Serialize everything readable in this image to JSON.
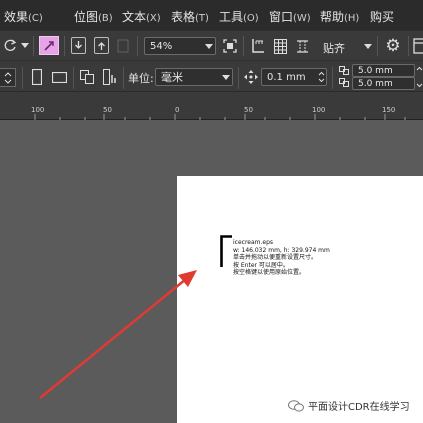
{
  "menu": {
    "items": [
      {
        "label": "效果",
        "hotkey": "(C)"
      },
      {
        "label": "位图",
        "hotkey": "(B)"
      },
      {
        "label": "文本",
        "hotkey": "(X)"
      },
      {
        "label": "表格",
        "hotkey": "(T)"
      },
      {
        "label": "工具",
        "hotkey": "(O)"
      },
      {
        "label": "窗口",
        "hotkey": "(W)"
      },
      {
        "label": "帮助",
        "hotkey": "(H)"
      },
      {
        "label": "购买",
        "hotkey": ""
      }
    ]
  },
  "toolbar": {
    "zoom_value": "54%",
    "snap_label": "贴齐"
  },
  "propertybar": {
    "units_label": "单位:",
    "units_value": "毫米",
    "nudge_value": "0.1 mm",
    "dup_x": "5.0 mm",
    "dup_y": "5.0 mm"
  },
  "ruler": {
    "ticks": [
      "100",
      "50",
      "0",
      "50",
      "100",
      "150"
    ]
  },
  "tooltip": {
    "filename": "icecream.eps",
    "size": "w: 146.032 mm, h: 329.974 mm",
    "line1": "单击并拖动以便重新设置尺寸。",
    "line2": "按 Enter 可以居中。",
    "line3": "按空格键以使用原始位置。"
  },
  "watermark": {
    "text": "平面设计CDR在线学习"
  },
  "colors": {
    "menubar": "#2b2b2b",
    "toolbar": "#3a3a3a",
    "canvas": "#5b5b5b",
    "page": "#ffffff",
    "arrow": "#e03a33",
    "highlight_button": "#e6a3e8"
  }
}
